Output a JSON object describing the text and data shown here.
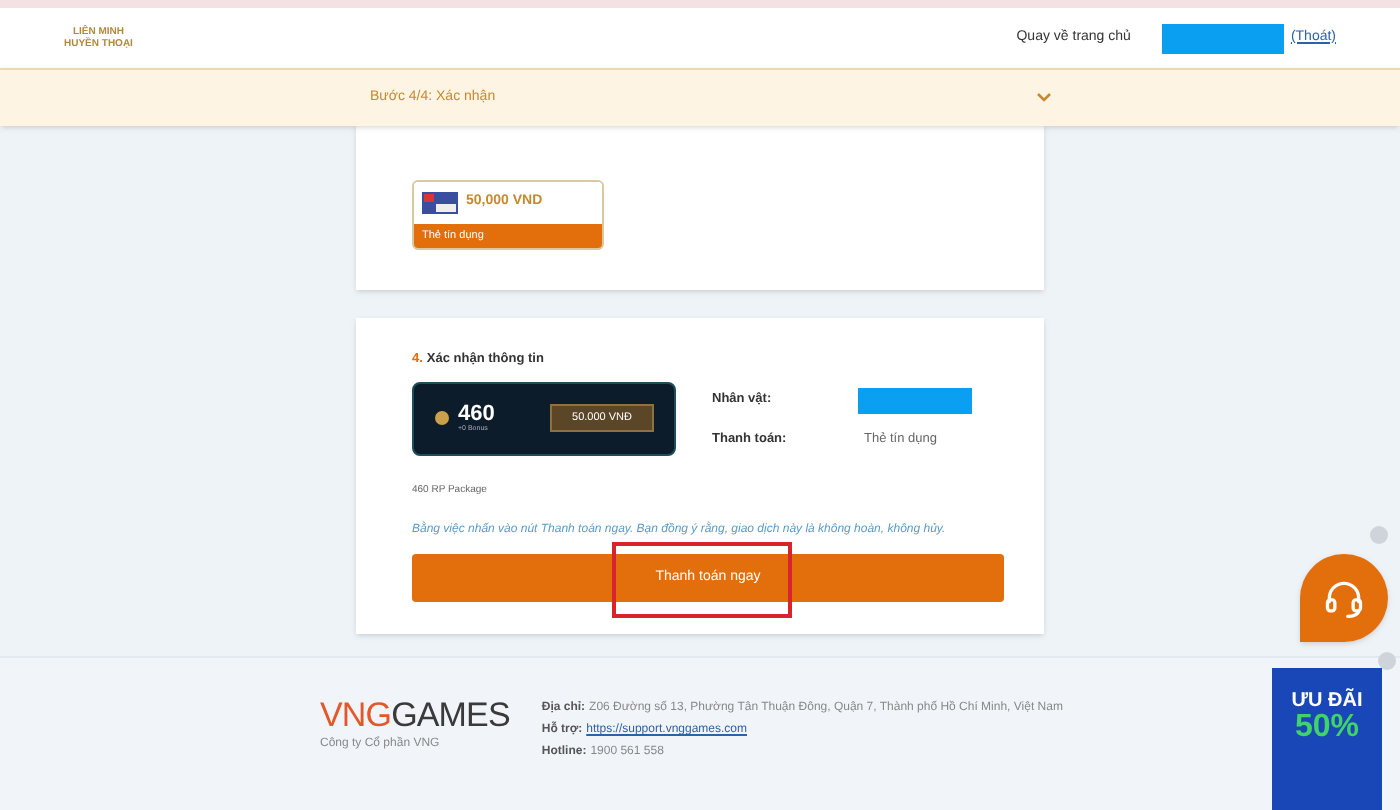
{
  "header": {
    "logo_lines": [
      "LIÊN MINH",
      "HUYỀN THOẠI"
    ],
    "home_link": "Quay về trang chủ",
    "logout_link": "(Thoát)"
  },
  "step": {
    "label": "Bước 4/4: Xác nhận",
    "expanded": false
  },
  "payment_card": {
    "amount": "50,000 VND",
    "method": "Thẻ tín dụng",
    "selected": true
  },
  "confirm": {
    "number": "4.",
    "title": "Xác nhận thông tin",
    "package_amount": "460",
    "package_bonus": "+0 Bonus",
    "package_price": "50.000 VNĐ",
    "fields": [
      {
        "label": "Nhân vật:",
        "kind": "masked"
      },
      {
        "label": "Thanh toán:",
        "value": "Thẻ tín dụng",
        "kind": "text"
      }
    ],
    "package_name": "460 RP Package",
    "notice": "Bằng việc nhấn vào nút Thanh toán ngay. Bạn đồng ý rằng, giao dịch này là không hoàn, không hủy.",
    "button": "Thanh toán ngay"
  },
  "footer": {
    "logo_left": "VNG",
    "logo_right": "GAMES",
    "company": "Công ty Cổ phần VNG",
    "lines": [
      {
        "label": "Địa chỉ:",
        "value": "Z06 Đường số 13, Phường Tân Thuận Đông, Quận 7, Thành phố Hồ Chí Minh, Việt Nam",
        "kind": "text"
      },
      {
        "label": "Hỗ trợ:",
        "value": "https://support.vnggames.com",
        "kind": "link"
      },
      {
        "label": "Hotline:",
        "value": "1900 561 558",
        "kind": "text"
      }
    ]
  },
  "promo": {
    "line1": "ƯU ĐÃI",
    "line2": "50%"
  }
}
